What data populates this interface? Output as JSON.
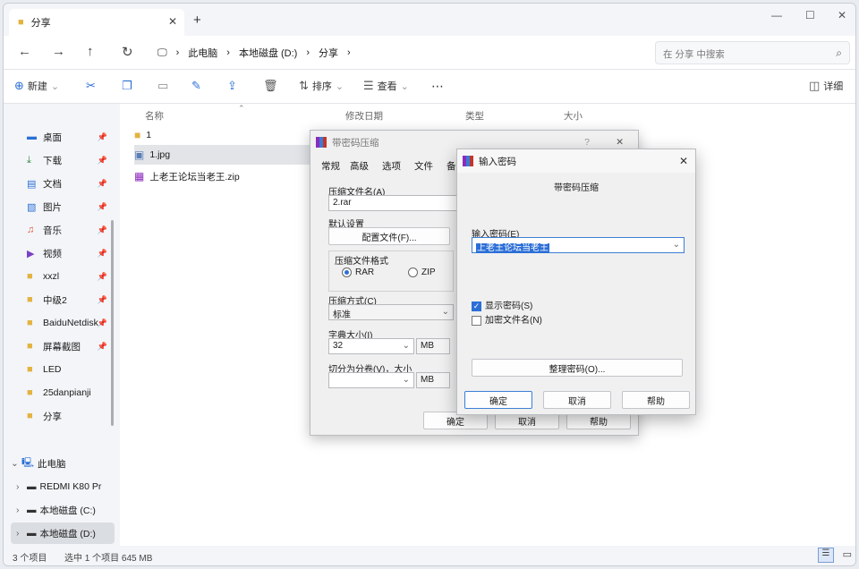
{
  "tab": {
    "title": "分享"
  },
  "breadcrumb": [
    "此电脑",
    "本地磁盘 (D:)",
    "分享"
  ],
  "search": {
    "placeholder": "在 分享 中搜索"
  },
  "toolbar": {
    "new": "新建",
    "sort": "排序",
    "view": "查看",
    "details": "详细"
  },
  "sidebar": {
    "quick": [
      {
        "label": "桌面",
        "icon": "desktop-icon",
        "color": "#2b6fd6",
        "pin": true
      },
      {
        "label": "下载",
        "icon": "download-icon",
        "color": "#2b8a3e",
        "pin": true
      },
      {
        "label": "文档",
        "icon": "document-icon",
        "color": "#2b6fd6",
        "pin": true
      },
      {
        "label": "图片",
        "icon": "pictures-icon",
        "color": "#2b6fd6",
        "pin": true
      },
      {
        "label": "音乐",
        "icon": "music-icon",
        "color": "#e0513b",
        "pin": true
      },
      {
        "label": "视频",
        "icon": "video-icon",
        "color": "#7b3fc4",
        "pin": true
      },
      {
        "label": "xxzl",
        "icon": "folder-icon",
        "color": "#e3b341",
        "pin": true
      },
      {
        "label": "中级2",
        "icon": "folder-icon",
        "color": "#e3b341",
        "pin": true
      },
      {
        "label": "BaiduNetdisk",
        "icon": "folder-icon",
        "color": "#e3b341",
        "pin": true
      },
      {
        "label": "屏幕截图",
        "icon": "folder-icon",
        "color": "#e3b341",
        "pin": true
      },
      {
        "label": "LED",
        "icon": "folder-icon",
        "color": "#e3b341",
        "pin": false
      },
      {
        "label": "25danpianji",
        "icon": "folder-icon",
        "color": "#e3b341",
        "pin": false
      },
      {
        "label": "分享",
        "icon": "folder-icon",
        "color": "#e3b341",
        "pin": false
      }
    ],
    "tree": [
      {
        "label": "此电脑",
        "level": 0,
        "chev": "⌄"
      },
      {
        "label": "REDMI K80 Pr",
        "level": 1,
        "chev": "›"
      },
      {
        "label": "本地磁盘 (C:)",
        "level": 1,
        "chev": "›"
      },
      {
        "label": "本地磁盘 (D:)",
        "level": 1,
        "chev": "›",
        "selected": true
      }
    ]
  },
  "columns": [
    "名称",
    "修改日期",
    "类型",
    "大小"
  ],
  "files": [
    {
      "name": "1",
      "icon": "folder-icon"
    },
    {
      "name": "1.jpg",
      "icon": "image-icon"
    },
    {
      "name": "上老王论坛当老王.zip",
      "icon": "archive-icon"
    }
  ],
  "status": {
    "count": "3 个项目",
    "selected": "选中 1 个项目  645 MB"
  },
  "archive_dialog": {
    "title": "带密码压缩",
    "tabs": [
      "常规",
      "高级",
      "选项",
      "文件",
      "备"
    ],
    "name_label": "压缩文件名(A)",
    "name_value": "2.rar",
    "defaults_label": "默认设置",
    "profiles_button": "配置文件(F)...",
    "format_label": "压缩文件格式",
    "format_rar": "RAR",
    "format_zip": "ZIP",
    "method_label": "压缩方式(C)",
    "method_value": "标准",
    "dict_label": "字典大小(I)",
    "dict_value": "32",
    "dict_unit": "MB",
    "split_label": "切分为分卷(V)，大小",
    "split_unit": "MB",
    "ok": "确定",
    "cancel": "取消",
    "help": "帮助"
  },
  "password_dialog": {
    "title": "输入密码",
    "subtitle": "带密码压缩",
    "enter_label": "输入密码(E)",
    "password_value": "上老王论坛当老王",
    "show_password": "显示密码(S)",
    "encrypt_names": "加密文件名(N)",
    "organize": "整理密码(O)...",
    "ok": "确定",
    "cancel": "取消",
    "help": "帮助"
  }
}
